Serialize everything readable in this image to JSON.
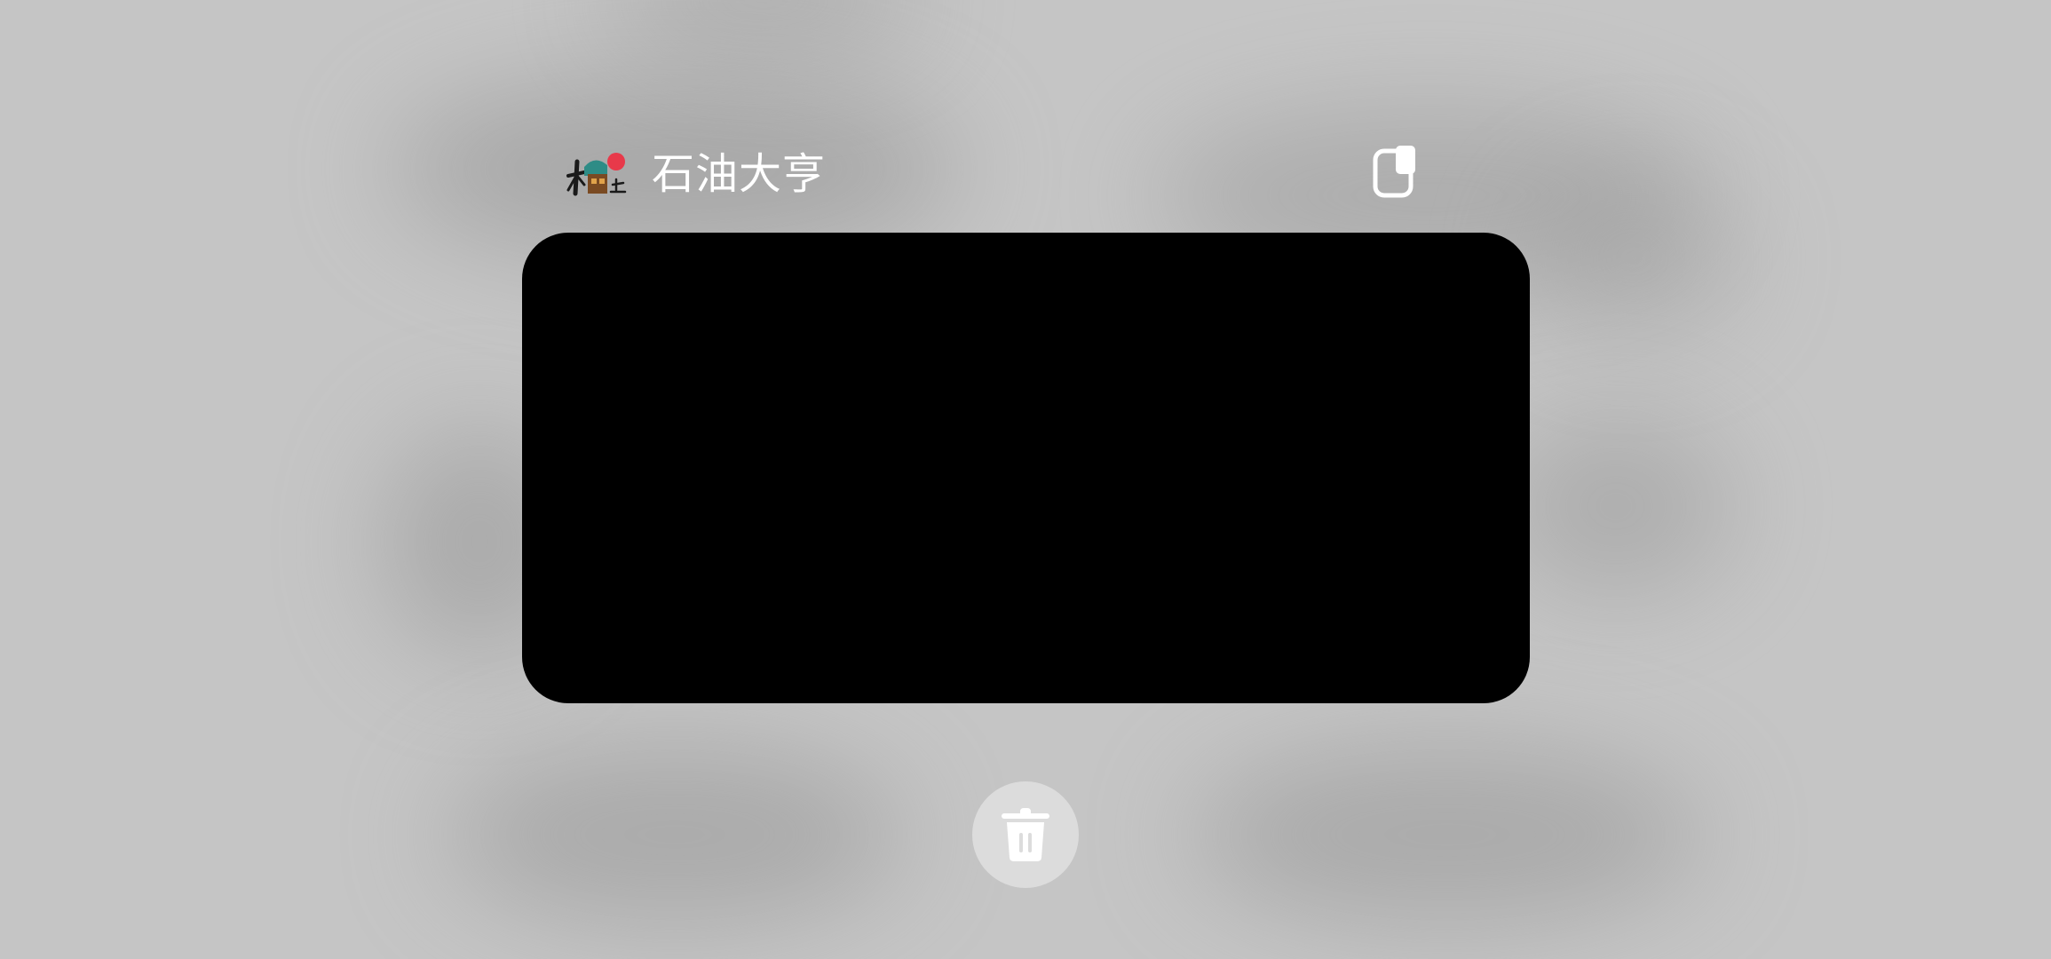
{
  "app": {
    "title": "石油大亨",
    "icon": "app-logo-icon"
  },
  "actions": {
    "split_icon": "split-screen-icon",
    "delete_icon": "trash-icon"
  },
  "colors": {
    "background": "#c5c5c5",
    "preview": "#000000",
    "title_text": "#ffffff",
    "trash_button": "#dcdcdc"
  }
}
